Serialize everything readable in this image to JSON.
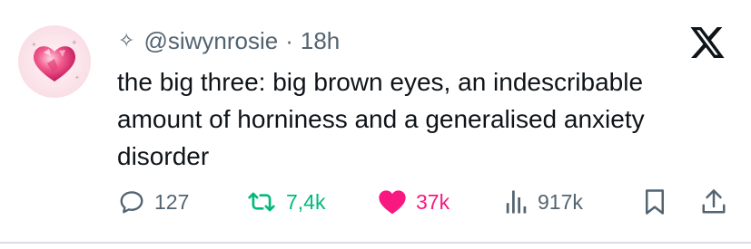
{
  "tweet": {
    "sparkle_icon": "sparkle-icon",
    "handle": "@siwynrosie",
    "separator": "·",
    "time": "18h",
    "text": "the big three: big brown eyes, an indescribable amount of horniness and a generalised anxiety disorder"
  },
  "actions": {
    "replies": "127",
    "reposts": "7,4k",
    "likes": "37k",
    "views": "917k"
  },
  "colors": {
    "retweet_green": "#00ba7c",
    "like_pink": "#f91880",
    "muted_gray": "#536471",
    "text": "#0f1419"
  }
}
